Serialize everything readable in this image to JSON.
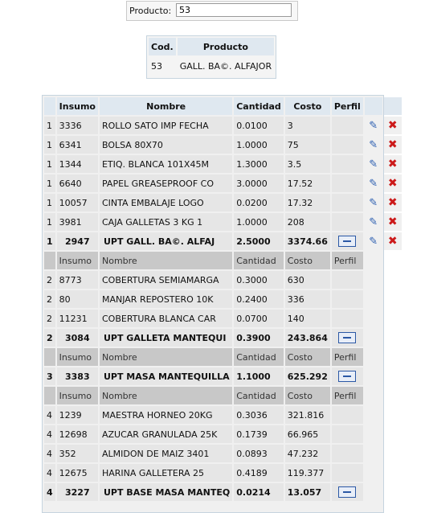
{
  "search": {
    "label": "Producto:",
    "value": "53"
  },
  "product_table": {
    "headers": [
      "Cod.",
      "Producto"
    ],
    "row": [
      "53",
      "GALL. BA©. ALFAJOR"
    ]
  },
  "main_table": {
    "headers": [
      "",
      "Insumo",
      "Nombre",
      "Cantidad",
      "Costo",
      "Perfil"
    ],
    "rows": [
      {
        "type": "item",
        "cells": [
          "1",
          "3336",
          "ROLLO SATO IMP FECHA",
          "0.0100",
          "3"
        ],
        "actions": true
      },
      {
        "type": "item",
        "cells": [
          "1",
          "6341",
          "BOLSA 80X70",
          "1.0000",
          "75"
        ],
        "actions": true
      },
      {
        "type": "item",
        "cells": [
          "1",
          "1344",
          "ETIQ. BLANCA 101X45M",
          "1.3000",
          "3.5"
        ],
        "actions": true
      },
      {
        "type": "item",
        "cells": [
          "1",
          "6640",
          "PAPEL GREASEPROOF CO",
          "3.0000",
          "17.52"
        ],
        "actions": true
      },
      {
        "type": "item",
        "cells": [
          "1",
          "10057",
          "CINTA EMBALAJE LOGO",
          "0.0200",
          "17.32"
        ],
        "actions": true
      },
      {
        "type": "item",
        "cells": [
          "1",
          "3981",
          "CAJA GALLETAS 3 KG 1",
          "1.0000",
          "208"
        ],
        "actions": true
      },
      {
        "type": "upt",
        "cells": [
          "1",
          "2947",
          "UPT GALL. BA©. ALFAJ",
          "2.5000",
          "3374.66"
        ],
        "actions": true
      },
      {
        "type": "sub",
        "cells": [
          "",
          "Insumo",
          "Nombre",
          "Cantidad",
          "Costo",
          "Perfil"
        ]
      },
      {
        "type": "item",
        "cells": [
          "2",
          "8773",
          "COBERTURA SEMIAMARGA",
          "0.3000",
          "630"
        ]
      },
      {
        "type": "item",
        "cells": [
          "2",
          "80",
          "MANJAR REPOSTERO 10K",
          "0.2400",
          "336"
        ]
      },
      {
        "type": "item",
        "cells": [
          "2",
          "11231",
          "COBERTURA BLANCA CAR",
          "0.0700",
          "140"
        ]
      },
      {
        "type": "upt",
        "cells": [
          "2",
          "3084",
          "UPT GALLETA MANTEQUI",
          "0.3900",
          "243.864"
        ]
      },
      {
        "type": "sub",
        "cells": [
          "",
          "Insumo",
          "Nombre",
          "Cantidad",
          "Costo",
          "Perfil"
        ]
      },
      {
        "type": "upt",
        "cells": [
          "3",
          "3383",
          "UPT MASA MANTEQUILLA",
          "1.1000",
          "625.292"
        ]
      },
      {
        "type": "sub",
        "cells": [
          "",
          "Insumo",
          "Nombre",
          "Cantidad",
          "Costo",
          "Perfil"
        ]
      },
      {
        "type": "item",
        "cells": [
          "4",
          "1239",
          "MAESTRA HORNEO 20KG",
          "0.3036",
          "321.816"
        ]
      },
      {
        "type": "item",
        "cells": [
          "4",
          "12698",
          "AZUCAR GRANULADA 25K",
          "0.1739",
          "66.965"
        ]
      },
      {
        "type": "item",
        "cells": [
          "4",
          "352",
          "ALMIDON DE MAIZ 3401",
          "0.0893",
          "47.232"
        ]
      },
      {
        "type": "item",
        "cells": [
          "4",
          "12675",
          "HARINA GALLETERA 25",
          "0.4189",
          "119.377"
        ]
      },
      {
        "type": "upt",
        "cells": [
          "4",
          "3227",
          "UPT BASE MASA MANTEQ",
          "0.0214",
          "13.057"
        ]
      }
    ]
  }
}
